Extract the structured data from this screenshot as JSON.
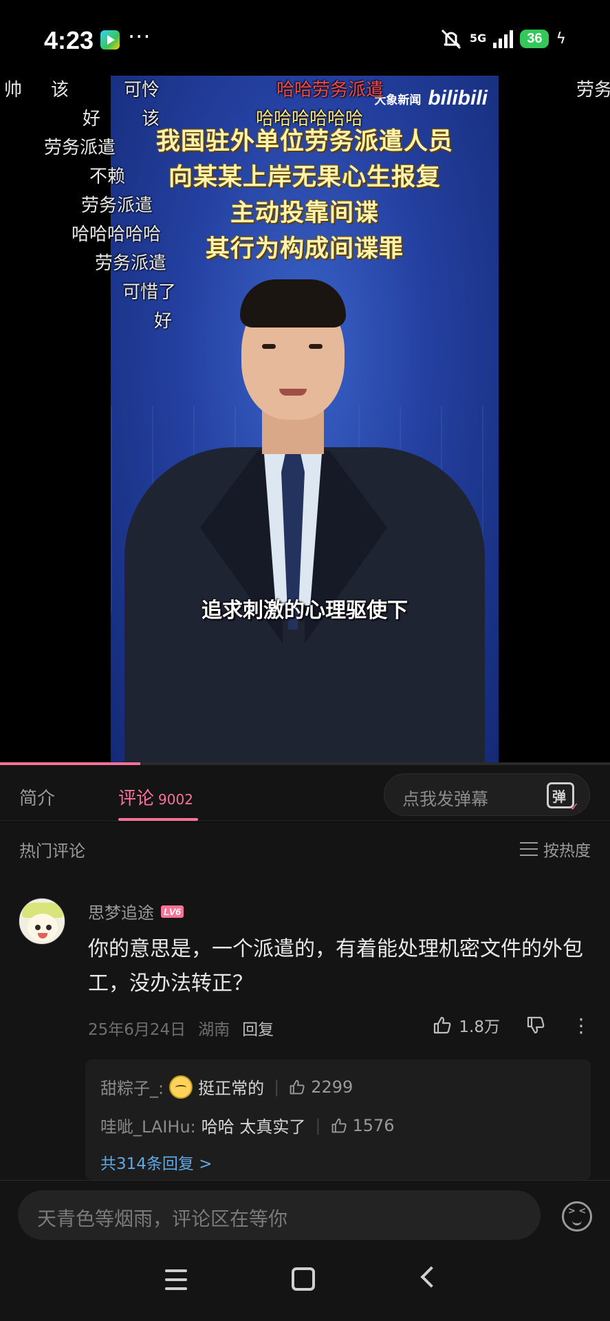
{
  "status_bar": {
    "time": "4:23",
    "more": "···",
    "network": "5G",
    "battery": "36"
  },
  "video": {
    "brand_news": "大象新闻",
    "brand_logo": "bilibili",
    "headline": [
      "我国驻外单位劳务派遣人员",
      "向某某上岸无果心生报复",
      "主动投靠间谍",
      "其行为构成间谍罪"
    ],
    "subtitle": "追求刺激的心理驱使下",
    "progress_fraction": 0.23,
    "danmaku": [
      {
        "text": "帅",
        "color": "white"
      },
      {
        "text": "该",
        "color": "white"
      },
      {
        "text": "可怜",
        "color": "white"
      },
      {
        "text": "哈哈劳务派遣",
        "color": "red"
      },
      {
        "text": "劳务",
        "color": "white"
      },
      {
        "text": "好",
        "color": "white"
      },
      {
        "text": "该",
        "color": "white"
      },
      {
        "text": "哈哈哈哈哈哈",
        "color": "yellow"
      },
      {
        "text": "劳务派遣",
        "color": "white"
      },
      {
        "text": "不赖",
        "color": "white"
      },
      {
        "text": "劳务派遣",
        "color": "white"
      },
      {
        "text": "哈哈哈哈哈",
        "color": "white"
      },
      {
        "text": "劳务派遣",
        "color": "white"
      },
      {
        "text": "可惜了",
        "color": "white"
      },
      {
        "text": "好",
        "color": "white"
      }
    ]
  },
  "tabs": {
    "intro": "简介",
    "comments": "评论",
    "comments_count": "9002",
    "danmu_placeholder": "点我发弹幕",
    "danmu_icon_char": "弹"
  },
  "comments": {
    "section_title": "热门评论",
    "sort_label": "按热度",
    "top_comment": {
      "username": "思梦追途",
      "level": "LV6",
      "text": "你的意思是，一个派遣的，有着能处理机密文件的外包工，没办法转正？",
      "date": "25年6月24日",
      "location": "湖南",
      "reply_label": "回复",
      "likes": "1.8万"
    },
    "replies": [
      {
        "name": "甜粽子_:",
        "text": "挺正常的",
        "likes": "2299",
        "has_emoji": true
      },
      {
        "name": "哇呲_LAIHu:",
        "text": "哈哈 太真实了",
        "likes": "1576",
        "has_emoji": false
      }
    ],
    "more_replies": "共314条回复 >"
  },
  "input_bar": {
    "placeholder": "天青色等烟雨，评论区在等你"
  },
  "colors": {
    "accent": "#fb7299",
    "link": "#5fa8e6",
    "background": "#141414"
  }
}
